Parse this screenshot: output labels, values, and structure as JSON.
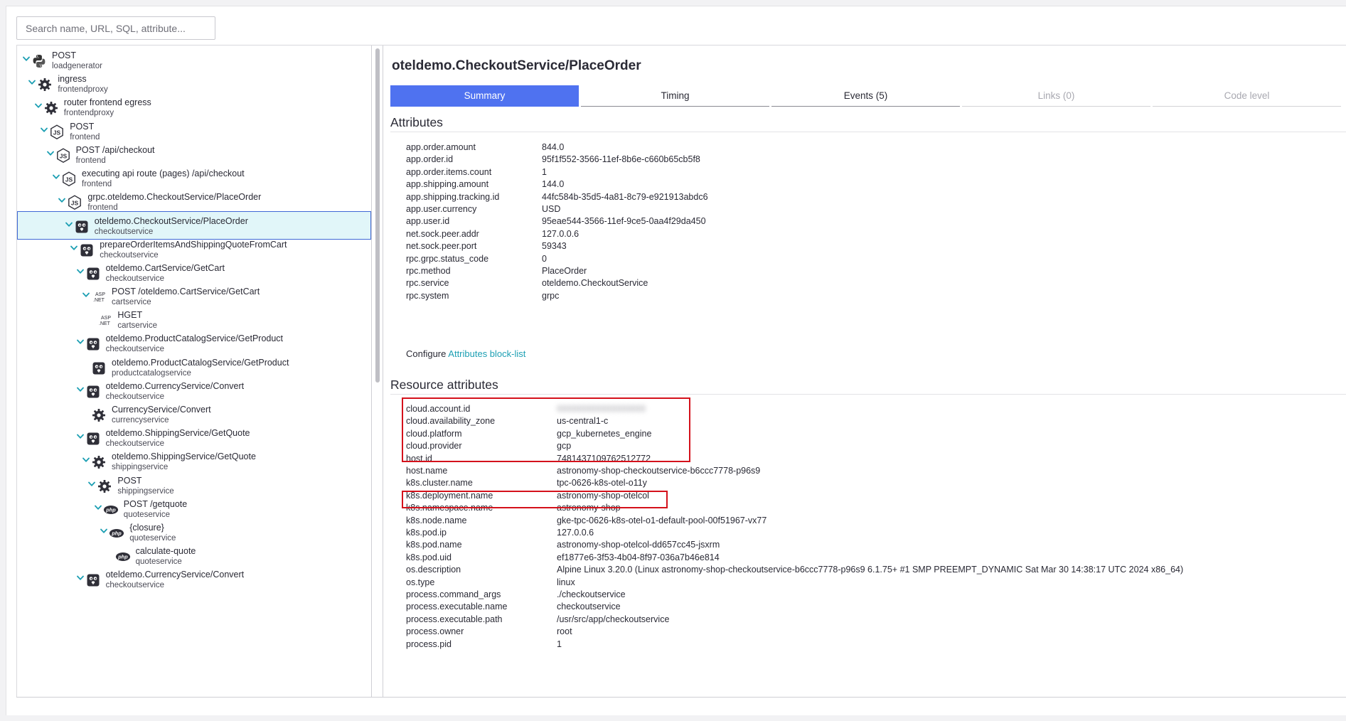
{
  "search": {
    "placeholder": "Search name, URL, SQL, attribute..."
  },
  "tree": [
    {
      "name": "POST",
      "service": "loadgenerator",
      "icon": "python",
      "depth": 0,
      "chevron": true
    },
    {
      "name": "ingress",
      "service": "frontendproxy",
      "icon": "gear",
      "depth": 1,
      "chevron": true
    },
    {
      "name": "router frontend egress",
      "service": "frontendproxy",
      "icon": "gear",
      "depth": 2,
      "chevron": true
    },
    {
      "name": "POST",
      "service": "frontend",
      "icon": "nodejs",
      "depth": 3,
      "chevron": true
    },
    {
      "name": "POST /api/checkout",
      "service": "frontend",
      "icon": "nodejs",
      "depth": 4,
      "chevron": true
    },
    {
      "name": "executing api route (pages) /api/checkout",
      "service": "frontend",
      "icon": "nodejs",
      "depth": 5,
      "chevron": true
    },
    {
      "name": "grpc.oteldemo.CheckoutService/PlaceOrder",
      "service": "frontend",
      "icon": "nodejs",
      "depth": 6,
      "chevron": true
    },
    {
      "name": "oteldemo.CheckoutService/PlaceOrder",
      "service": "checkoutservice",
      "icon": "go",
      "depth": 7,
      "chevron": true,
      "selected": true
    },
    {
      "name": "prepareOrderItemsAndShippingQuoteFromCart",
      "service": "checkoutservice",
      "icon": "go",
      "depth": 8,
      "chevron": true
    },
    {
      "name": "oteldemo.CartService/GetCart",
      "service": "checkoutservice",
      "icon": "go",
      "depth": 9,
      "chevron": true
    },
    {
      "name": "POST /oteldemo.CartService/GetCart",
      "service": "cartservice",
      "icon": "aspnet",
      "depth": 10,
      "chevron": true
    },
    {
      "name": "HGET",
      "service": "cartservice",
      "icon": "aspnet",
      "depth": 11,
      "chevron": false
    },
    {
      "name": "oteldemo.ProductCatalogService/GetProduct",
      "service": "checkoutservice",
      "icon": "go",
      "depth": 9,
      "chevron": true
    },
    {
      "name": "oteldemo.ProductCatalogService/GetProduct",
      "service": "productcatalogservice",
      "icon": "go",
      "depth": 10,
      "chevron": false
    },
    {
      "name": "oteldemo.CurrencyService/Convert",
      "service": "checkoutservice",
      "icon": "go",
      "depth": 9,
      "chevron": true
    },
    {
      "name": "CurrencyService/Convert",
      "service": "currencyservice",
      "icon": "gear",
      "depth": 10,
      "chevron": false
    },
    {
      "name": "oteldemo.ShippingService/GetQuote",
      "service": "checkoutservice",
      "icon": "go",
      "depth": 9,
      "chevron": true
    },
    {
      "name": "oteldemo.ShippingService/GetQuote",
      "service": "shippingservice",
      "icon": "gear",
      "depth": 10,
      "chevron": true
    },
    {
      "name": "POST",
      "service": "shippingservice",
      "icon": "gear",
      "depth": 11,
      "chevron": true
    },
    {
      "name": "POST /getquote",
      "service": "quoteservice",
      "icon": "php",
      "depth": 12,
      "chevron": true
    },
    {
      "name": "{closure}",
      "service": "quoteservice",
      "icon": "php",
      "depth": 13,
      "chevron": true
    },
    {
      "name": "calculate-quote",
      "service": "quoteservice",
      "icon": "php",
      "depth": 14,
      "chevron": false
    },
    {
      "name": "oteldemo.CurrencyService/Convert",
      "service": "checkoutservice",
      "icon": "go",
      "depth": 9,
      "chevron": true
    }
  ],
  "detail": {
    "title": "oteldemo.CheckoutService/PlaceOrder",
    "tabs": [
      {
        "label": "Summary",
        "state": "active"
      },
      {
        "label": "Timing",
        "state": "normal"
      },
      {
        "label": "Events (5)",
        "state": "normal"
      },
      {
        "label": "Links (0)",
        "state": "disabled"
      },
      {
        "label": "Code level",
        "state": "disabled"
      }
    ],
    "attributes_title": "Attributes",
    "attributes": [
      {
        "key": "app.order.amount",
        "value": "844.0"
      },
      {
        "key": "app.order.id",
        "value": "95f1f552-3566-11ef-8b6e-c660b65cb5f8"
      },
      {
        "key": "app.order.items.count",
        "value": "1"
      },
      {
        "key": "app.shipping.amount",
        "value": "144.0"
      },
      {
        "key": "app.shipping.tracking.id",
        "value": "44fc584b-35d5-4a81-8c79-e921913abdc6"
      },
      {
        "key": "app.user.currency",
        "value": "USD"
      },
      {
        "key": "app.user.id",
        "value": "95eae544-3566-11ef-9ce5-0aa4f29da450"
      },
      {
        "key": "net.sock.peer.addr",
        "value": "127.0.0.6"
      },
      {
        "key": "net.sock.peer.port",
        "value": "59343"
      },
      {
        "key": "rpc.grpc.status_code",
        "value": "0"
      },
      {
        "key": "rpc.method",
        "value": "PlaceOrder"
      },
      {
        "key": "rpc.service",
        "value": "oteldemo.CheckoutService"
      },
      {
        "key": "rpc.system",
        "value": "grpc"
      }
    ],
    "configure_text": "Configure",
    "configure_link": "Attributes block-list",
    "resource_title": "Resource attributes",
    "resource_attributes": [
      {
        "key": "cloud.account.id",
        "value": "000000000000000000",
        "redacted": true
      },
      {
        "key": "cloud.availability_zone",
        "value": "us-central1-c"
      },
      {
        "key": "cloud.platform",
        "value": "gcp_kubernetes_engine"
      },
      {
        "key": "cloud.provider",
        "value": "gcp"
      },
      {
        "key": "host.id",
        "value": "7481437109762512772"
      },
      {
        "key": "host.name",
        "value": "astronomy-shop-checkoutservice-b6ccc7778-p96s9"
      },
      {
        "key": "k8s.cluster.name",
        "value": "tpc-0626-k8s-otel-o11y"
      },
      {
        "key": "k8s.deployment.name",
        "value": "astronomy-shop-otelcol"
      },
      {
        "key": "k8s.namespace.name",
        "value": "astronomy-shop"
      },
      {
        "key": "k8s.node.name",
        "value": "gke-tpc-0626-k8s-otel-o1-default-pool-00f51967-vx77"
      },
      {
        "key": "k8s.pod.ip",
        "value": "127.0.0.6"
      },
      {
        "key": "k8s.pod.name",
        "value": "astronomy-shop-otelcol-dd657cc45-jsxrm"
      },
      {
        "key": "k8s.pod.uid",
        "value": "ef1877e6-3f53-4b04-8f97-036a7b46e814"
      },
      {
        "key": "os.description",
        "value": "Alpine Linux 3.20.0 (Linux astronomy-shop-checkoutservice-b6ccc7778-p96s9 6.1.75+ #1 SMP PREEMPT_DYNAMIC Sat Mar 30 14:38:17 UTC 2024 x86_64)"
      },
      {
        "key": "os.type",
        "value": "linux"
      },
      {
        "key": "process.command_args",
        "value": "./checkoutservice"
      },
      {
        "key": "process.executable.name",
        "value": "checkoutservice"
      },
      {
        "key": "process.executable.path",
        "value": "/usr/src/app/checkoutservice"
      },
      {
        "key": "process.owner",
        "value": "root"
      },
      {
        "key": "process.pid",
        "value": "1"
      }
    ]
  },
  "colors": {
    "accent": "#4f72f0",
    "link": "#1c9fb3",
    "highlight_box": "#d4111b",
    "selected_row_bg": "#e1f6f9",
    "chevron": "#1c9fb3"
  }
}
